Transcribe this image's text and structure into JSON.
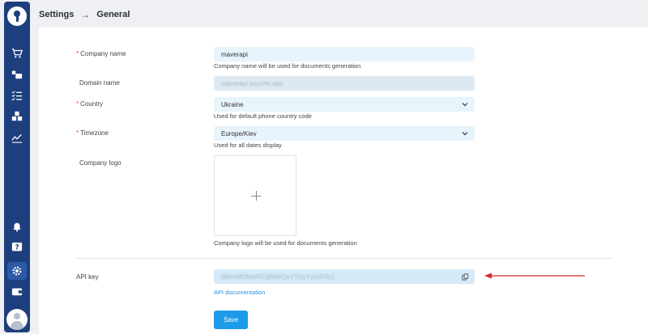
{
  "breadcrumb": {
    "section": "Settings",
    "page": "General"
  },
  "sidebar": {
    "items": [
      {
        "icon": "cart-icon"
      },
      {
        "icon": "users-icon"
      },
      {
        "icon": "checklist-icon"
      },
      {
        "icon": "boxes-icon"
      },
      {
        "icon": "trend-chart-icon"
      },
      {
        "icon": "bell-icon"
      },
      {
        "icon": "help-icon"
      },
      {
        "icon": "settings-gear-icon",
        "active": true
      },
      {
        "icon": "wallet-icon"
      }
    ]
  },
  "form": {
    "company_name": {
      "label": "Company name",
      "value": "maverapi",
      "help": "Company name will be used for documents generation"
    },
    "domain_name": {
      "label": "Domain name",
      "value": "maverapi.keycrm.app"
    },
    "country": {
      "label": "Country",
      "value": "Ukraine",
      "help": "Used for default phone country code"
    },
    "timezone": {
      "label": "Timezone",
      "value": "Europe/Kiev",
      "help": "Used for all dates display"
    },
    "company_logo": {
      "label": "Company logo",
      "help": "Company logo will be used for documents generation"
    },
    "api_key": {
      "label": "API key",
      "value": "MjhmM2MwNTdjMWQxYTUyYzkxNTc1",
      "link": "API documentation"
    },
    "save_label": "Save"
  },
  "colors": {
    "sidebar": "#1d3f7e",
    "accent": "#1e9be8",
    "annotation_arrow": "#d42a2a"
  }
}
